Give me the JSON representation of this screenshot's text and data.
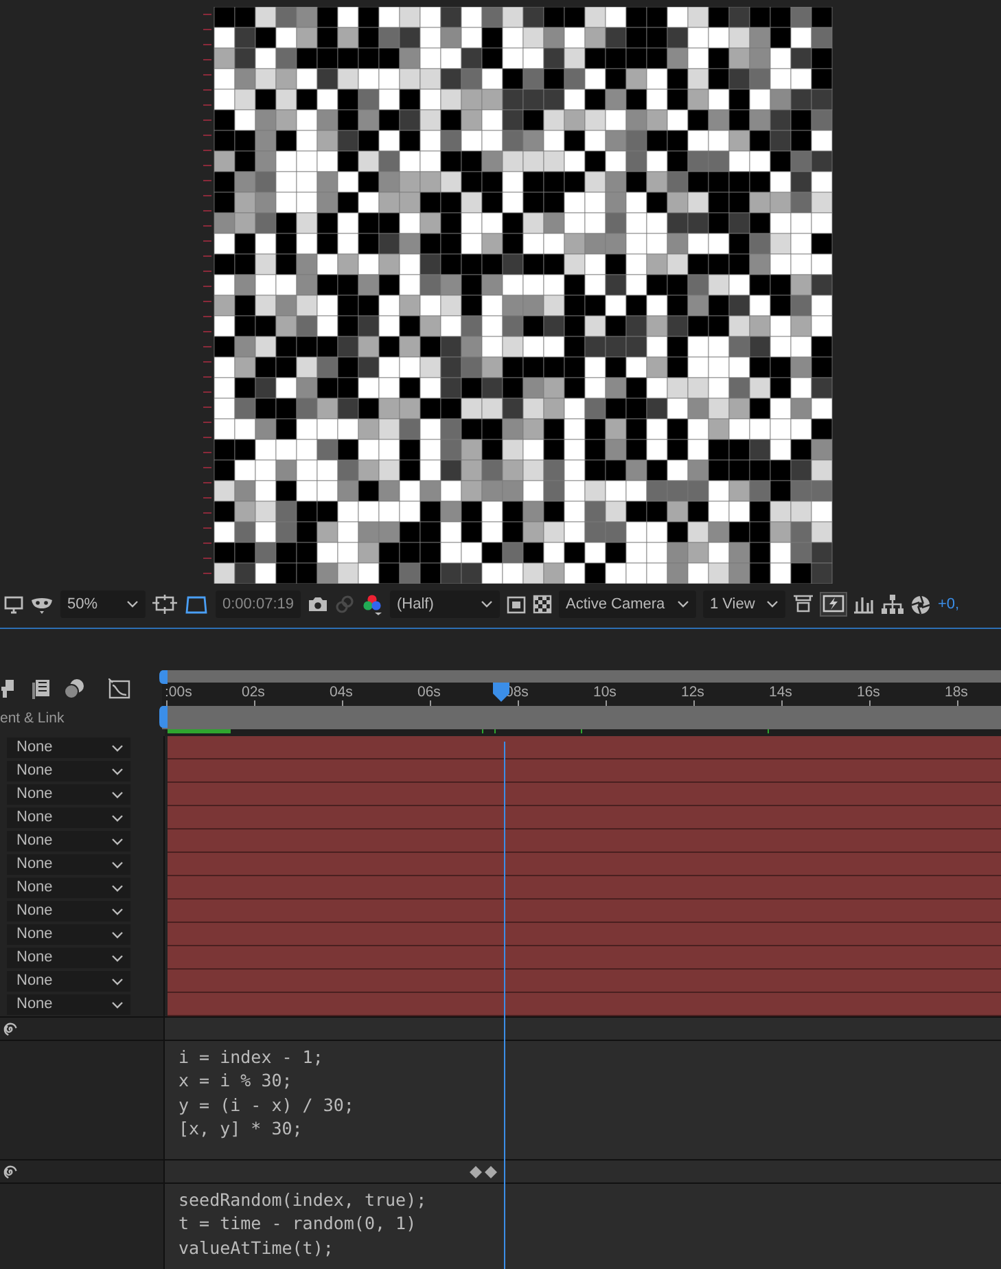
{
  "viewer_toolbar": {
    "zoom": "50%",
    "timecode": "0:00:07:19",
    "resolution": "(Half)",
    "camera": "Active Camera",
    "views": "1 View",
    "exposure": "+0,"
  },
  "timeline": {
    "ruler_labels": [
      ":00s",
      "02s",
      "04s",
      "06s",
      "08s",
      "10s",
      "12s",
      "14s",
      "16s",
      "18s"
    ],
    "playhead": {
      "level": 0.405
    },
    "column_header": "ent & Link",
    "layers": [
      {
        "parent": "None"
      },
      {
        "parent": "None"
      },
      {
        "parent": "None"
      },
      {
        "parent": "None"
      },
      {
        "parent": "None"
      },
      {
        "parent": "None"
      },
      {
        "parent": "None"
      },
      {
        "parent": "None"
      },
      {
        "parent": "None"
      },
      {
        "parent": "None"
      },
      {
        "parent": "None"
      },
      {
        "parent": "None"
      }
    ],
    "expressions": [
      {
        "lines": [
          "i = index - 1;",
          "x = i % 30;",
          "y = (i - x) / 30;",
          "[x, y] * 30;"
        ],
        "keyframes": false
      },
      {
        "lines": [
          "seedRandom(index, true);",
          "t = time - random(0, 1)",
          "valueAtTime(t);"
        ],
        "keyframes": true
      }
    ]
  }
}
